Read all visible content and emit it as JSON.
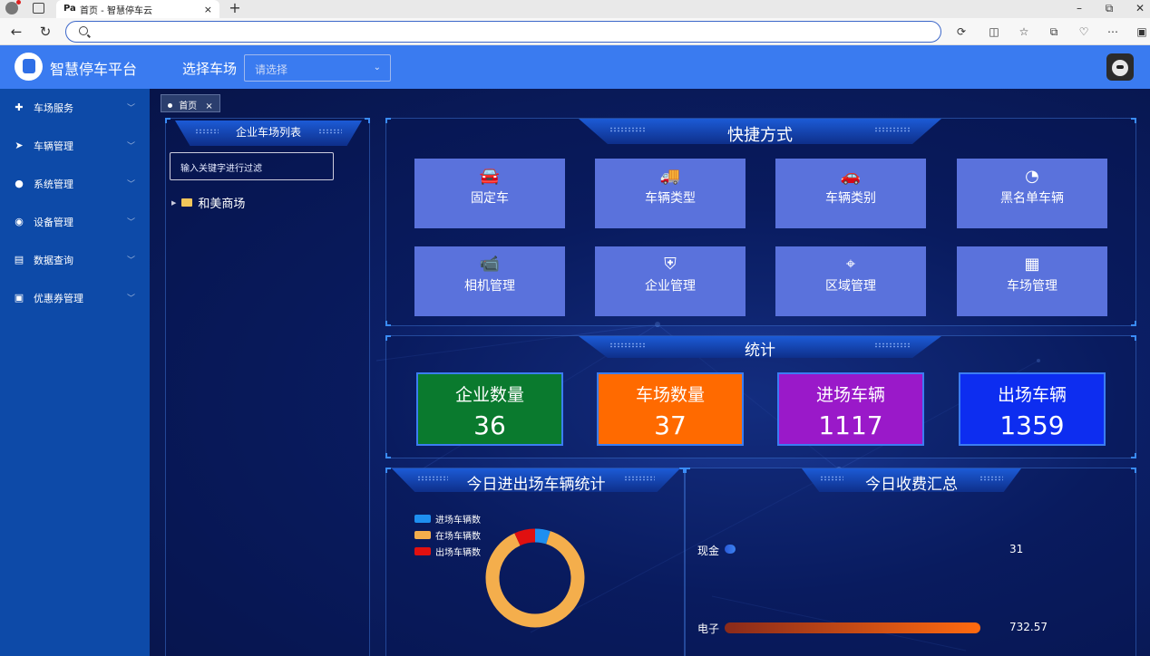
{
  "browser": {
    "tab_title": "首页 - 智慧停车云",
    "tab_icon": "Pa",
    "tab_close": "×",
    "new_tab": "+",
    "window_controls": [
      "–",
      "⧉",
      "✕"
    ]
  },
  "header": {
    "app_title": "智慧停车平台",
    "select_caption": "选择车场",
    "select_placeholder": "请选择"
  },
  "sidebar": {
    "items": [
      {
        "label": "车场服务",
        "icon": "plus-circle-icon",
        "glyph": "✚"
      },
      {
        "label": "车辆管理",
        "icon": "paper-plane-icon",
        "glyph": "➤"
      },
      {
        "label": "系统管理",
        "icon": "user-icon",
        "glyph": "●"
      },
      {
        "label": "设备管理",
        "icon": "camera-icon",
        "glyph": "◉"
      },
      {
        "label": "数据查询",
        "icon": "clipboard-icon",
        "glyph": "▤"
      },
      {
        "label": "优惠券管理",
        "icon": "gift-icon",
        "glyph": "▣"
      }
    ]
  },
  "tags": {
    "home": "首页",
    "close": "×"
  },
  "left_panel": {
    "title": "企业车场列表",
    "filter_placeholder": "输入关键字进行过滤",
    "tree_item": "和美商场"
  },
  "quick": {
    "title": "快捷方式",
    "buttons": [
      {
        "label": "固定车",
        "icon": "car-gear-icon",
        "glyph": "🚘"
      },
      {
        "label": "车辆类型",
        "icon": "truck-icon",
        "glyph": "🚚"
      },
      {
        "label": "车辆类别",
        "icon": "car-icon",
        "glyph": "🚗"
      },
      {
        "label": "黑名单车辆",
        "icon": "pie-chart-icon",
        "glyph": "◔"
      },
      {
        "label": "相机管理",
        "icon": "cctv-icon",
        "glyph": "📹"
      },
      {
        "label": "企业管理",
        "icon": "shield-icon",
        "glyph": "⛨"
      },
      {
        "label": "区域管理",
        "icon": "target-icon",
        "glyph": "⌖"
      },
      {
        "label": "车场管理",
        "icon": "grid-icon",
        "glyph": "▦"
      }
    ]
  },
  "stats": {
    "title": "统计",
    "cards": [
      {
        "label": "企业数量",
        "value": "36",
        "color": "#0a7a2e"
      },
      {
        "label": "车场数量",
        "value": "37",
        "color": "#ff6a00"
      },
      {
        "label": "进场车辆",
        "value": "1117",
        "color": "#9a19c9"
      },
      {
        "label": "出场车辆",
        "value": "1359",
        "color": "#0d2df0"
      }
    ]
  },
  "today_vehicles": {
    "title": "今日进出场车辆统计",
    "legend": [
      {
        "label": "进场车辆数",
        "color": "#1e8ff0"
      },
      {
        "label": "在场车辆数",
        "color": "#f4ae4c"
      },
      {
        "label": "出场车辆数",
        "color": "#e01010"
      }
    ]
  },
  "chart_data": {
    "type": "pie",
    "donut": true,
    "categories": [
      "进场车辆数",
      "在场车辆数",
      "出场车辆数"
    ],
    "values": [
      5,
      88,
      7
    ],
    "colors": [
      "#1e8ff0",
      "#f4ae4c",
      "#e01010"
    ]
  },
  "today_fees": {
    "title": "今日收费汇总",
    "rows": [
      {
        "label": "现金",
        "value": "31",
        "amount": 31
      },
      {
        "label": "电子",
        "value": "732.57",
        "amount": 732.57
      }
    ]
  }
}
